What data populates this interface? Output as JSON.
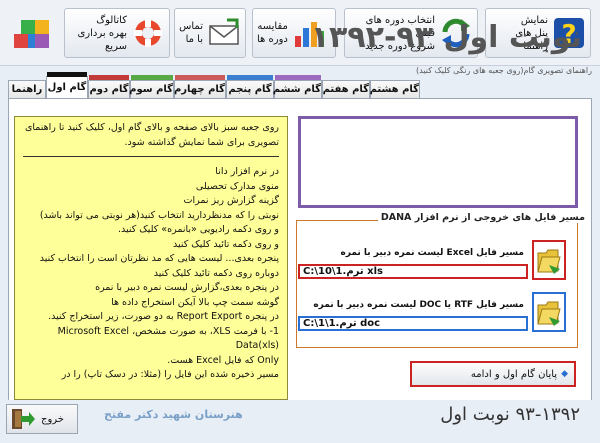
{
  "toolbar": {
    "help": {
      "line1": "نمایش",
      "line2": "پنل های راهنما"
    },
    "select_period": {
      "line1": "انتخاب دوره های قبلی",
      "line2": "شروع دوره جدید"
    },
    "compare": {
      "line1": "مقایسه",
      "line2": "دوره ها"
    },
    "contact": {
      "line1": "تماس با ما"
    },
    "catalog": {
      "line1": "کاتالوگ",
      "line2": "بهره برداری سریع"
    }
  },
  "hint": "راهنمای تصویری گام(روی جعبه های رنگی کلیک کنید)",
  "tabs": [
    {
      "label": "راهنما"
    },
    {
      "label": "گام اول",
      "color": "#111111",
      "active": true
    },
    {
      "label": "گام دوم",
      "color": "#c23a3a"
    },
    {
      "label": "گام سوم",
      "color": "#58a845"
    },
    {
      "label": "گام چهارم",
      "color": "#cc5a5a"
    },
    {
      "label": "گام پنجم",
      "color": "#3b7fd0"
    },
    {
      "label": "گام ششم",
      "color": "#9c6bbf"
    },
    {
      "label": "گام هفتم"
    },
    {
      "label": "گام هشتم"
    }
  ],
  "info": {
    "intro": "روی جعبه سبز بالای صفحه و بالای گام اول، کلیک کنید تا راهنمای تصویری برای شما نمایش گذاشته شود.",
    "lines": [
      "در نرم افزار دانا",
      "منوی مدارک تحصیلی",
      "گزینه گزارش ریز نمرات",
      "نوبتی را که مدنظردارید انتخاب کنید(هر نوبتی می تواند باشد)",
      "و روی دکمه رادیویی «بانمره» کلیک کنید.",
      "و روی دکمه تائید کلیک کنید",
      "پنجره بعدی... لیست هایی که مد نظرتان است را انتخاب کنید",
      "دوباره روی دکمه تائید کلیک کنید",
      "در پنجره بعدی،گزارش لیست نمره دبیر با نمره",
      "گوشه سمت چپ بالا آیکن استخراج داده ها",
      "در پنجره Report Export به دو صورت، زیر استخراج کنید.",
      "1- با فرمت XLS، به صورت مشخص، Microsoft Excel Data(xls)",
      "Only که فایل Excel هست.",
      "مسیر ذخیره شده این فایل را (مثلا: در دسک تاپ) را در"
    ]
  },
  "title": "نوبت اول ۹۳-۱۳۹۲",
  "group": {
    "legend": "مسیر فایل های خروجی از نرم افزار DANA",
    "excel_label": "مسیر فایل Excel لیست نمره دبیر با نمره",
    "excel_path": "C:\\10\\1.ترم xls",
    "doc_label": "مسیر فایل RTF یا DOC لیست نمره دبیر با نمره",
    "doc_path": "C:\\1\\1.ترم doc"
  },
  "finish_button": "پایان گام اول و ادامه",
  "exit_button": "خروج",
  "school": "هنرستان شهید دکتر مفتح",
  "bottom_title": "۹۳-۱۳۹۲ نوبت اول"
}
